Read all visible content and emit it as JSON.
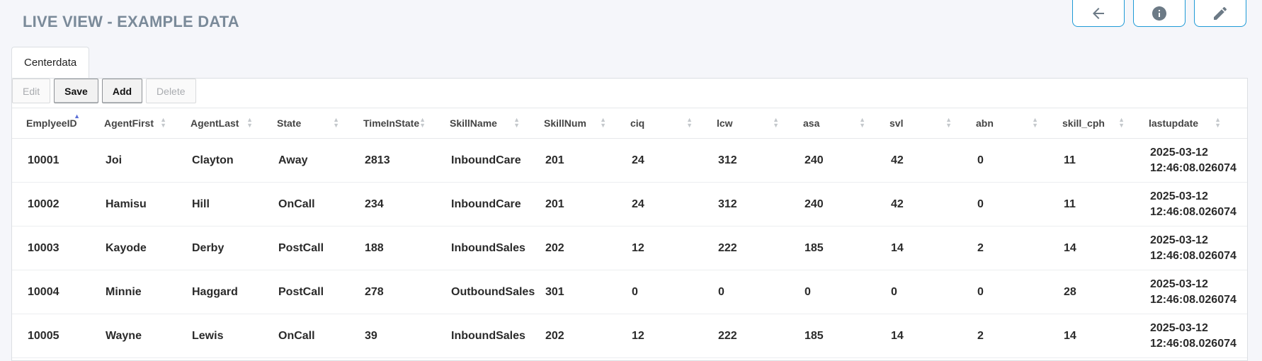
{
  "page": {
    "title": "LIVE VIEW - EXAMPLE DATA"
  },
  "top_actions": [
    {
      "name": "back-button",
      "icon": "arrow-left-icon"
    },
    {
      "name": "info-button",
      "icon": "info-icon"
    },
    {
      "name": "edit-button",
      "icon": "pencil-icon"
    }
  ],
  "tabs": [
    {
      "label": "Centerdata"
    }
  ],
  "toolbar": {
    "edit_label": "Edit",
    "save_label": "Save",
    "add_label": "Add",
    "delete_label": "Delete"
  },
  "table": {
    "columns": [
      "EmplyeeID",
      "AgentFirst",
      "AgentLast",
      "State",
      "TimeInState",
      "SkillName",
      "SkillNum",
      "ciq",
      "lcw",
      "asa",
      "svl",
      "abn",
      "skill_cph",
      "lastupdate"
    ],
    "sorted_column": "EmplyeeID",
    "sort_direction": "ascending",
    "rows": [
      [
        "10001",
        "Joi",
        "Clayton",
        "Away",
        "2813",
        "InboundCare",
        "201",
        "24",
        "312",
        "240",
        "42",
        "0",
        "11",
        "2025-03-12\n12:46:08.026074"
      ],
      [
        "10002",
        "Hamisu",
        "Hill",
        "OnCall",
        "234",
        "InboundCare",
        "201",
        "24",
        "312",
        "240",
        "42",
        "0",
        "11",
        "2025-03-12\n12:46:08.026074"
      ],
      [
        "10003",
        "Kayode",
        "Derby",
        "PostCall",
        "188",
        "InboundSales",
        "202",
        "12",
        "222",
        "185",
        "14",
        "2",
        "14",
        "2025-03-12\n12:46:08.026074"
      ],
      [
        "10004",
        "Minnie",
        "Haggard",
        "PostCall",
        "278",
        "OutboundSales",
        "301",
        "0",
        "0",
        "0",
        "0",
        "0",
        "28",
        "2025-03-12\n12:46:08.026074"
      ],
      [
        "10005",
        "Wayne",
        "Lewis",
        "OnCall",
        "39",
        "InboundSales",
        "202",
        "12",
        "222",
        "185",
        "14",
        "2",
        "14",
        "2025-03-12\n12:46:08.026074"
      ]
    ]
  },
  "colors": {
    "accent": "#1e9ad6",
    "title": "#7a8a99",
    "sort_active": "#5b6fd6"
  }
}
